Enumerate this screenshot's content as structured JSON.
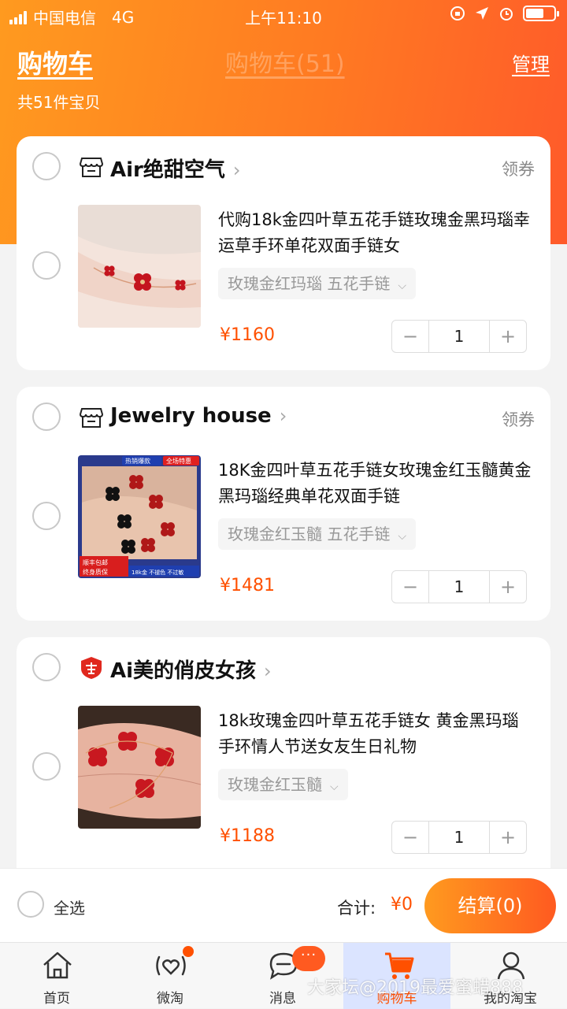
{
  "status_bar": {
    "carrier": "中国电信",
    "network": "4G",
    "time": "上午11:10"
  },
  "header": {
    "title": "购物车",
    "center_title": "购物车(51)",
    "manage_label": "管理",
    "item_count_text": "共51件宝贝"
  },
  "shops": [
    {
      "name": "Air绝甜空气",
      "coupon_label": "领券",
      "item": {
        "title": "代购18k金四叶草五花手链玫瑰金黑玛瑙幸运草手环单花双面手链女",
        "sku": "玫瑰金红玛瑙 五花手链",
        "price": "¥1160",
        "quantity": "1"
      }
    },
    {
      "name": "Jewelry house",
      "coupon_label": "领券",
      "item": {
        "title": "18K金四叶草五花手链女玫瑰金红玉髓黄金黑玛瑙经典单花双面手链",
        "sku": "玫瑰金红玉髓 五花手链",
        "price": "¥1481",
        "quantity": "1",
        "image_tags": [
          "热销爆款",
          "全场特惠",
          "顺丰包邮",
          "终身质保",
          "18k金 不褪色 不过敏"
        ]
      }
    },
    {
      "name": "Ai美的俏皮女孩",
      "item": {
        "title": "18k玫瑰金四叶草五花手链女 黄金黑玛瑙手环情人节送女友生日礼物",
        "sku": "玫瑰金红玉髓",
        "price": "¥1188",
        "quantity": "1"
      }
    }
  ],
  "stepper": {
    "minus": "−",
    "plus": "+"
  },
  "footer": {
    "select_all_label": "全选",
    "total_label": "合计:",
    "total_value": "¥0",
    "checkout_label": "结算(0)"
  },
  "tabbar": {
    "items": [
      {
        "label": "首页",
        "icon": "home-icon"
      },
      {
        "label": "微淘",
        "icon": "weitao-icon"
      },
      {
        "label": "消息",
        "icon": "message-icon",
        "badge": "···"
      },
      {
        "label": "购物车",
        "icon": "cart-icon",
        "active": true
      },
      {
        "label": "我的淘宝",
        "icon": "profile-icon"
      }
    ]
  },
  "watermark": "大家坛@2019最爱蜜蜡888",
  "colors": {
    "accent": "#ff5000",
    "header_gradient_start": "#ff9a1f",
    "header_gradient_end": "#ff5a2a",
    "active_tab_bg": "#dbe4ff"
  }
}
